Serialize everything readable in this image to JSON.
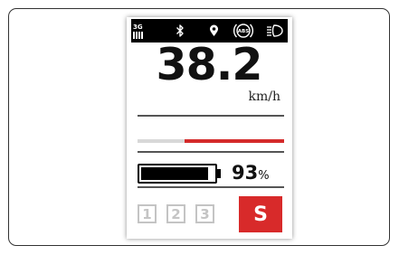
{
  "status_bar": {
    "network": "3G",
    "icons": [
      "signal-bars-icon",
      "bluetooth-icon",
      "location-pin-icon",
      "abs-icon",
      "headlight-icon"
    ],
    "abs_label": "ABS"
  },
  "speed": {
    "value": "38.2",
    "unit": "km/h"
  },
  "assist_level": {
    "fill_fraction": 0.68,
    "fill_color": "#d42a2a",
    "track_color": "#d8d8d8"
  },
  "battery": {
    "percent_value": "93",
    "percent_symbol": "%",
    "level": 0.93
  },
  "gears": {
    "options": [
      "1",
      "2",
      "3"
    ],
    "selected": "S",
    "selected_color": "#d82a2a"
  }
}
